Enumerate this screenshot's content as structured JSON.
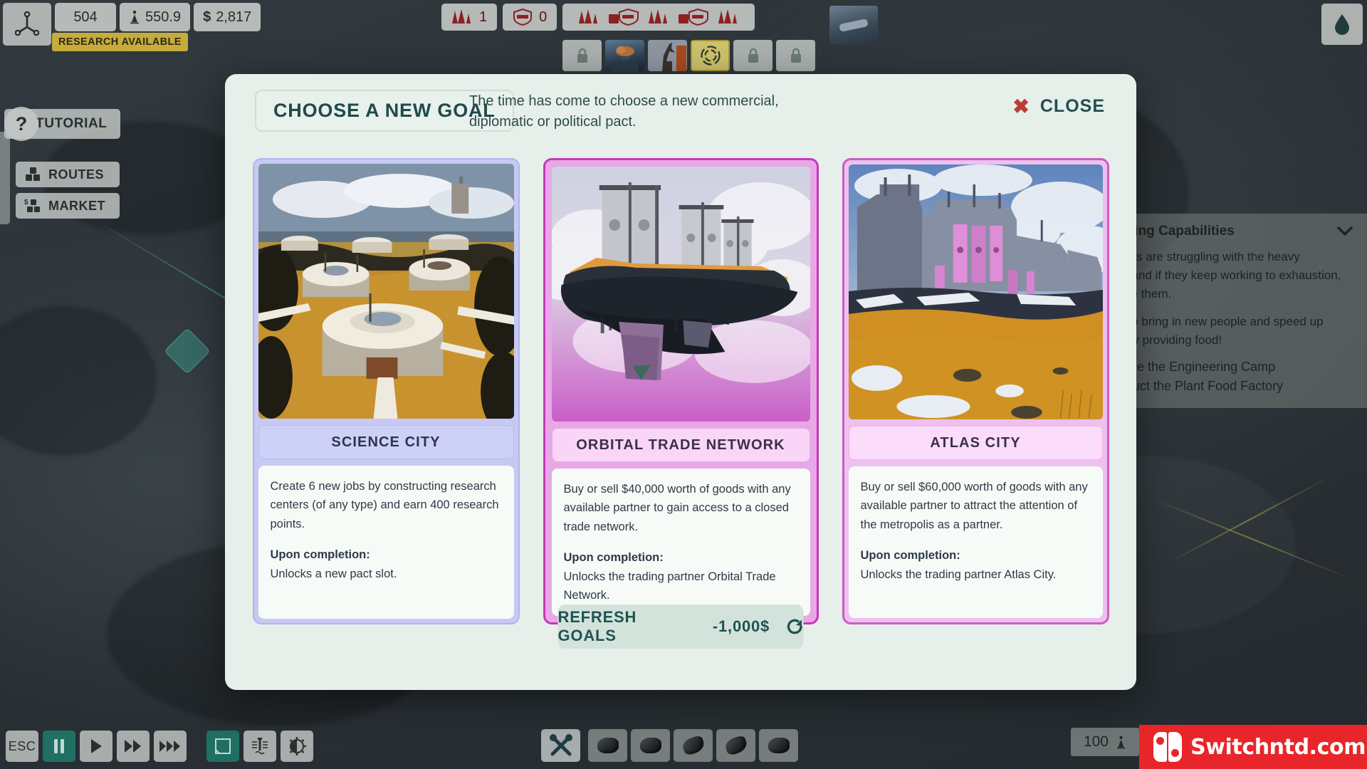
{
  "hud": {
    "logo_icon": "research-tree-icon",
    "resources": [
      {
        "name": "research-points",
        "icon": "",
        "value": "504"
      },
      {
        "name": "population",
        "icon": "population-icon",
        "value": "550.9"
      },
      {
        "name": "money",
        "icon": "dollar-icon",
        "value": "2,817"
      }
    ],
    "research_badge": "RESEARCH AVAILABLE",
    "military": [
      {
        "name": "troops-chip",
        "icon": "troops-icon",
        "value": "1"
      },
      {
        "name": "firewall-chip",
        "icon": "firewall-shield-icon",
        "value": "0"
      }
    ],
    "military_wide_icons": [
      "troops-icon",
      "firewall-shield-icon",
      "troops-icon",
      "firewall-shield-icon",
      "troops-icon"
    ],
    "slots": [
      {
        "name": "slot-locked-1",
        "state": "locked",
        "icon": "lock-icon"
      },
      {
        "name": "slot-art-balloon",
        "state": "filled",
        "icon": "balloon-city-icon"
      },
      {
        "name": "slot-art-statue",
        "state": "filled",
        "icon": "statue-icon"
      },
      {
        "name": "slot-active-pact",
        "state": "active",
        "icon": "pact-target-icon"
      },
      {
        "name": "slot-locked-2",
        "state": "locked",
        "icon": "lock-icon"
      },
      {
        "name": "slot-locked-3",
        "state": "locked",
        "icon": "lock-icon"
      }
    ],
    "water_button_icon": "water-drop-icon",
    "minimap_icon": "airship-thumbnail",
    "tutorial_label": "TUTORIAL",
    "tutorial_icon": "question-mark-icon",
    "left_buttons": [
      {
        "name": "routes-button",
        "label": "ROUTES",
        "icon": "crates-icon"
      },
      {
        "name": "market-button",
        "label": "MARKET",
        "icon": "market-crates-dollar-icon"
      }
    ]
  },
  "right_panel": {
    "title": "Engineering Capabilities",
    "collapse_icon": "chevron-down-icon",
    "paragraph_1": "Our workers are struggling with the heavy workload, and if they keep working to exhaustion, we will lose them.",
    "paragraph_2": "We need to bring in new people and speed up recovery by providing food!",
    "tasks": [
      {
        "name": "task-engineering-camp",
        "label": "Upgrade the Engineering Camp",
        "done": true
      },
      {
        "name": "task-plant-food-factory",
        "label": "Construct the Plant Food Factory",
        "done": true
      }
    ]
  },
  "bottom_bar": {
    "controls": [
      {
        "name": "esc-button",
        "label": "ESC",
        "icon": "esc-text",
        "active": false
      },
      {
        "name": "pause-button",
        "label": "",
        "icon": "pause-icon",
        "active": true
      },
      {
        "name": "play-button",
        "label": "",
        "icon": "play-icon",
        "active": false
      },
      {
        "name": "fast-forward-button",
        "label": "",
        "icon": "double-arrow-icon",
        "active": false
      },
      {
        "name": "ultra-fast-forward-button",
        "label": "",
        "icon": "triple-arrow-icon",
        "active": false
      },
      {
        "name": "overlay-toggle-button",
        "label": "",
        "icon": "square-overlay-icon",
        "active": true
      },
      {
        "name": "water-level-button",
        "label": "",
        "icon": "water-gauge-icon",
        "active": false
      },
      {
        "name": "brightness-button",
        "label": "",
        "icon": "brightness-icon",
        "active": false
      }
    ],
    "build_slots": [
      {
        "name": "build-tools-button",
        "icon": "wrench-cross-icon"
      },
      {
        "name": "build-rock-1",
        "icon": "rock-icon"
      },
      {
        "name": "build-rock-2",
        "icon": "rock-icon"
      },
      {
        "name": "build-rock-3",
        "icon": "twin-rock-icon"
      },
      {
        "name": "build-rock-4",
        "icon": "twin-rock-icon"
      },
      {
        "name": "build-rock-5",
        "icon": "rock-icon"
      }
    ],
    "population_chip": {
      "value": "100",
      "icon": "population-icon"
    },
    "watermark": "Switchntd.com",
    "watermark_icon": "nintendo-switch-logo"
  },
  "modal": {
    "title": "CHOOSE A NEW GOAL",
    "subtitle": "The time has come to choose a new commercial, diplomatic or political pact.",
    "close_label": "CLOSE",
    "close_icon": "close-x-icon",
    "refresh": {
      "label": "REFRESH GOALS",
      "cost": "-1,000$",
      "icon": "refresh-circular-arrow-icon"
    },
    "cards": [
      {
        "name": "science-city",
        "title": "SCIENCE CITY",
        "art": "science-city-artwork",
        "objective": "Create 6 new jobs by constructing research centers (of any type) and earn 400 research points.",
        "completion_label": "Upon completion:",
        "completion_text": "Unlocks a new pact slot.",
        "accent": "#b0b4ee"
      },
      {
        "name": "orbital-trade-network",
        "title": "ORBITAL TRADE NETWORK",
        "art": "orbital-trade-network-artwork",
        "objective": "Buy or sell $40,000 worth of goods with any available partner to gain access to a closed trade network.",
        "completion_label": "Upon completion:",
        "completion_text": "Unlocks the trading partner Orbital Trade Network.",
        "accent": "#c438bd"
      },
      {
        "name": "atlas-city",
        "title": "ATLAS CITY",
        "art": "atlas-city-artwork",
        "objective": "Buy or sell $60,000 worth of goods with any available partner to attract the attention of the metropolis as a partner.",
        "completion_label": "Upon completion:",
        "completion_text": "Unlocks the trading partner Atlas City.",
        "accent": "#c85ec4"
      }
    ]
  }
}
